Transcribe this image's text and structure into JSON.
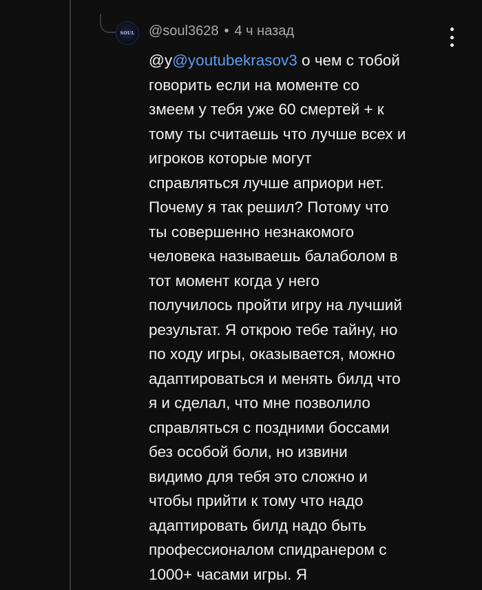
{
  "comment": {
    "author": "@soul3628",
    "separator": "•",
    "time": "4 ч назад",
    "avatar_text": "SOUL",
    "prefix": "@y",
    "mention": "@youtubekrasov3",
    "lines": [
      " о чем с тобой",
      "говорить если на моменте со",
      "змеем у тебя уже 60 смертей + к",
      "тому ты считаешь что лучше всех и",
      "игроков которые могут",
      "справляться лучше априори нет.",
      "Почему я так решил? Потому что",
      "ты совершенно незнакомого",
      "человека называешь балаболом в",
      "тот момент когда у него",
      "получилось пройти игру на лучший",
      "результат. Я открою тебе тайну, но",
      "по ходу игры, оказывается, можно",
      "адаптироваться и менять билд что",
      "я и сделал, что мне позволило",
      "справляться с поздними боссами",
      "без особой боли, но извини",
      "видимо для тебя это сложно и",
      "чтобы прийти к тому что надо",
      "адаптировать билд надо быть",
      "профессионалом спидранером с",
      "1000+ часами игры. Я"
    ]
  },
  "colors": {
    "background": "#0f0f0f",
    "text": "#f1f1f1",
    "meta": "#aaaaaa",
    "mention": "#5c9cf0",
    "thread_line": "#3a3a3a"
  },
  "icons": {
    "more": "vertical-ellipsis-icon"
  }
}
